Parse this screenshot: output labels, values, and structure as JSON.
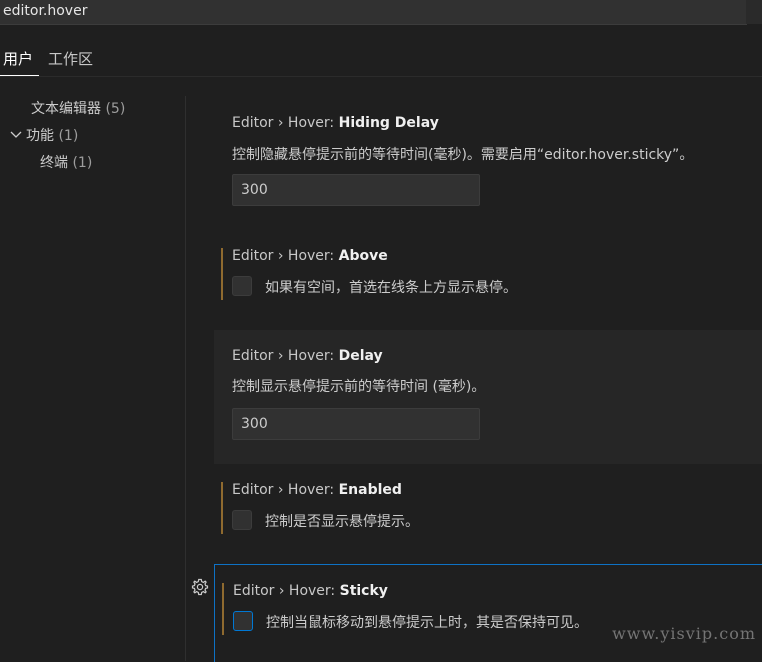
{
  "search": {
    "query": "editor.hover"
  },
  "tabs": [
    {
      "label": "用户"
    },
    {
      "label": "工作区"
    }
  ],
  "toc": {
    "items": [
      {
        "label": "文本编辑器",
        "count": "(5)"
      },
      {
        "label": "功能",
        "count": "(1)"
      },
      {
        "label": "终端",
        "count": "(1)"
      }
    ]
  },
  "settings": {
    "hiding_delay": {
      "category": "Editor › Hover: ",
      "name": "Hiding Delay",
      "description": "控制隐藏悬停提示前的等待时间(毫秒)。需要启用“editor.hover.sticky”。",
      "value": "300"
    },
    "above": {
      "category": "Editor › Hover: ",
      "name": "Above",
      "description": "如果有空间，首选在线条上方显示悬停。",
      "checked": false
    },
    "delay": {
      "category": "Editor › Hover: ",
      "name": "Delay",
      "description": "控制显示悬停提示前的等待时间 (毫秒)。",
      "value": "300"
    },
    "enabled": {
      "category": "Editor › Hover: ",
      "name": "Enabled",
      "description": "控制是否显示悬停提示。",
      "checked": false
    },
    "sticky": {
      "category": "Editor › Hover: ",
      "name": "Sticky",
      "description": "控制当鼠标移动到悬停提示上时，其是否保持可见。",
      "checked": false
    }
  },
  "watermark": "www.yisvip.com",
  "colors": {
    "accent": "#0078d4",
    "modified": "#8f6a2f",
    "background": "#1f1f1f"
  },
  "icons": {
    "settings_gear": "gear-icon",
    "chevron": "chevron-down-icon"
  }
}
